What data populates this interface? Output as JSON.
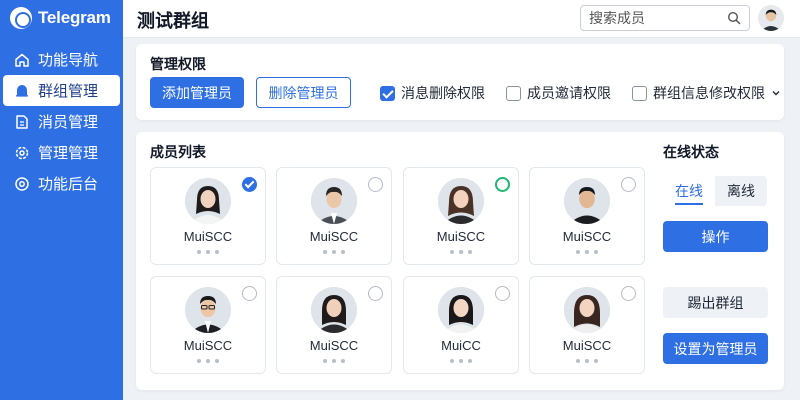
{
  "app": {
    "name": "Telegram"
  },
  "sidebar": {
    "items": [
      {
        "label": "功能导航",
        "icon": "home-icon",
        "active": false
      },
      {
        "label": "群组管理",
        "icon": "bell-icon",
        "active": true
      },
      {
        "label": "消员管理",
        "icon": "document-icon",
        "active": false
      },
      {
        "label": "管理管理",
        "icon": "gear-icon",
        "active": false
      },
      {
        "label": "功能后台",
        "icon": "target-icon",
        "active": false
      }
    ]
  },
  "header": {
    "title": "测试群组",
    "search_placeholder": "搜索成员"
  },
  "admin": {
    "title": "管理权限",
    "add_button": "添加管理员",
    "remove_button": "删除管理员",
    "permissions": [
      {
        "label": "消息删除权限",
        "checked": true
      },
      {
        "label": "成员邀请权限",
        "checked": false
      },
      {
        "label": "群组信息修改权限",
        "checked": false
      }
    ]
  },
  "members": {
    "title": "成员列表",
    "list": [
      {
        "name": "MuiSCC",
        "selected": true,
        "indicator": "checked"
      },
      {
        "name": "MuiSCC",
        "selected": false,
        "indicator": "none"
      },
      {
        "name": "MuiSCC",
        "selected": false,
        "indicator": "online"
      },
      {
        "name": "MuiSCC",
        "selected": false,
        "indicator": "none"
      },
      {
        "name": "MuiSCC",
        "selected": false,
        "indicator": "none"
      },
      {
        "name": "MuiSCC",
        "selected": false,
        "indicator": "none"
      },
      {
        "name": "MuiCC",
        "selected": false,
        "indicator": "none"
      },
      {
        "name": "MuiSCC",
        "selected": false,
        "indicator": "none"
      }
    ]
  },
  "status": {
    "title": "在线状态",
    "tabs": [
      "在线",
      "离线"
    ],
    "active_tab": "在线",
    "action_button": "操作",
    "kick_button": "踢出群组",
    "set_admin_button": "设置为管理员"
  },
  "colors": {
    "primary": "#2f6fe4",
    "online": "#22b573",
    "background": "#eef1f6"
  }
}
